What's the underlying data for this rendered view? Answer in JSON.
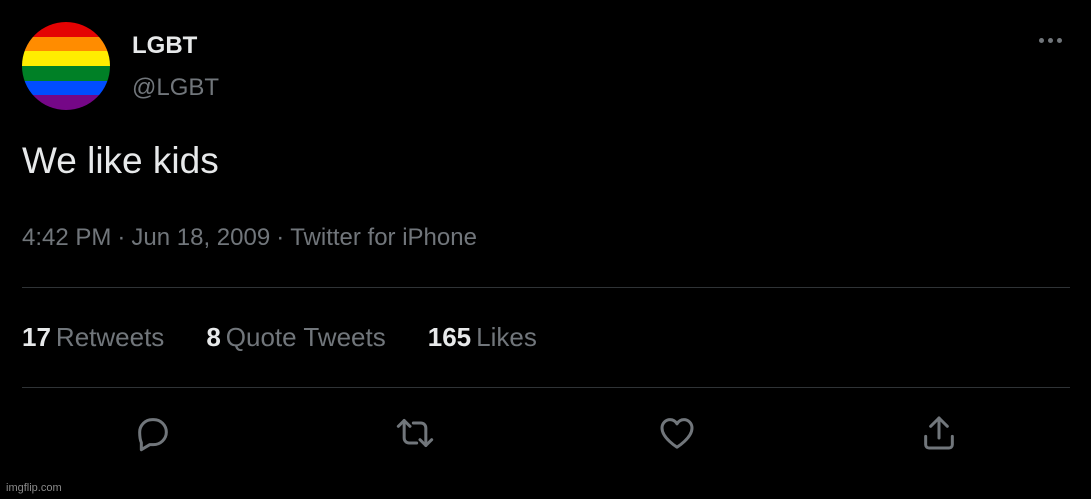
{
  "tweet": {
    "display_name": "LGBT",
    "handle": "@LGBT",
    "text": "We like kids",
    "time": "4:42 PM",
    "date": "Jun 18, 2009",
    "source": "Twitter for iPhone",
    "separator": "·"
  },
  "stats": {
    "retweets_count": "17",
    "retweets_label": "Retweets",
    "quotes_count": "8",
    "quotes_label": "Quote Tweets",
    "likes_count": "165",
    "likes_label": "Likes"
  },
  "actions": {
    "reply_icon": "reply-icon",
    "retweet_icon": "retweet-icon",
    "like_icon": "heart-icon",
    "share_icon": "share-icon"
  },
  "avatar": {
    "colors": [
      "#e40303",
      "#ff8c00",
      "#ffed00",
      "#008026",
      "#004dff",
      "#750787"
    ]
  },
  "watermark": "imgflip.com"
}
